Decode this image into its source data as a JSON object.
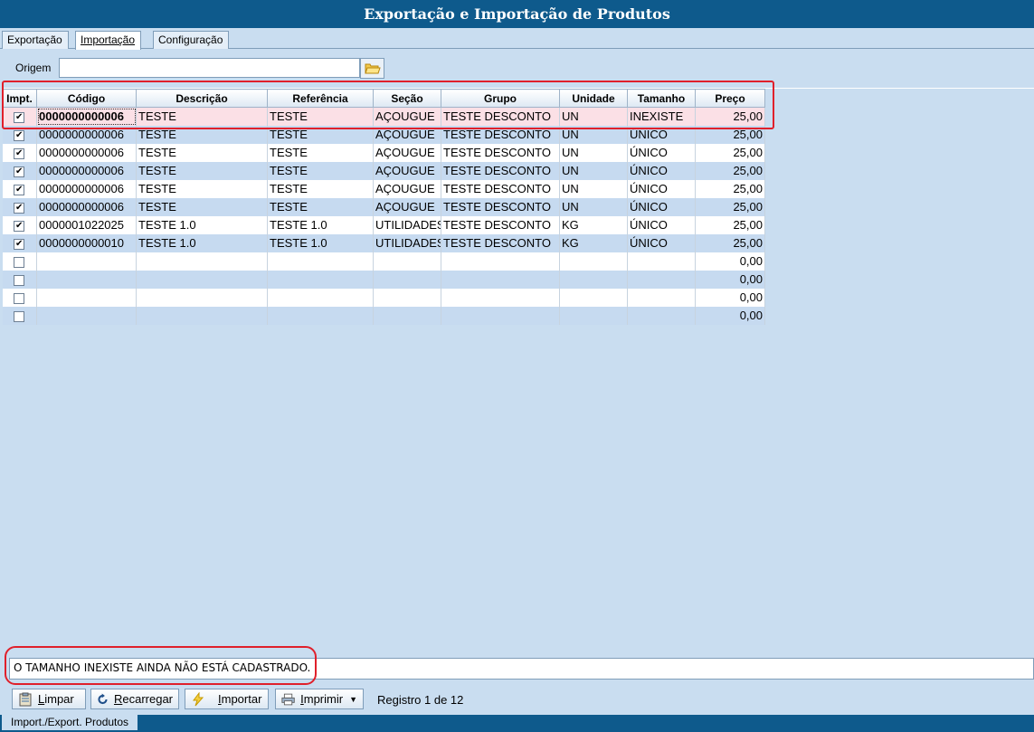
{
  "window": {
    "title": "Exportação e Importação de Produtos"
  },
  "tabs": [
    {
      "label": "Exportação"
    },
    {
      "label": "Importação"
    },
    {
      "label": "Configuração"
    }
  ],
  "origem": {
    "label": "Origem",
    "value": ""
  },
  "grid": {
    "columns": [
      "Impt.",
      "Código",
      "Descrição",
      "Referência",
      "Seção",
      "Grupo",
      "Unidade",
      "Tamanho",
      "Preço"
    ],
    "rows": [
      {
        "checked": true,
        "codigo": "0000000000006",
        "descricao": "TESTE",
        "referencia": "TESTE",
        "secao": "AÇOUGUE",
        "grupo": "TESTE DESCONTO",
        "unidade": "UN",
        "tamanho": "INEXISTE",
        "preco": "25,00"
      },
      {
        "checked": true,
        "codigo": "0000000000006",
        "descricao": "TESTE",
        "referencia": "TESTE",
        "secao": "AÇOUGUE",
        "grupo": "TESTE DESCONTO",
        "unidade": "UN",
        "tamanho": "ÚNICO",
        "preco": "25,00"
      },
      {
        "checked": true,
        "codigo": "0000000000006",
        "descricao": "TESTE",
        "referencia": "TESTE",
        "secao": "AÇOUGUE",
        "grupo": "TESTE DESCONTO",
        "unidade": "UN",
        "tamanho": "ÚNICO",
        "preco": "25,00"
      },
      {
        "checked": true,
        "codigo": "0000000000006",
        "descricao": "TESTE",
        "referencia": "TESTE",
        "secao": "AÇOUGUE",
        "grupo": "TESTE DESCONTO",
        "unidade": "UN",
        "tamanho": "ÚNICO",
        "preco": "25,00"
      },
      {
        "checked": true,
        "codigo": "0000000000006",
        "descricao": "TESTE",
        "referencia": "TESTE",
        "secao": "AÇOUGUE",
        "grupo": "TESTE DESCONTO",
        "unidade": "UN",
        "tamanho": "ÚNICO",
        "preco": "25,00"
      },
      {
        "checked": true,
        "codigo": "0000000000006",
        "descricao": "TESTE",
        "referencia": "TESTE",
        "secao": "AÇOUGUE",
        "grupo": "TESTE DESCONTO",
        "unidade": "UN",
        "tamanho": "ÚNICO",
        "preco": "25,00"
      },
      {
        "checked": true,
        "codigo": "0000001022025",
        "descricao": "TESTE 1.0",
        "referencia": "TESTE 1.0",
        "secao": "UTILIDADES",
        "grupo": "TESTE DESCONTO",
        "unidade": "KG",
        "tamanho": "ÚNICO",
        "preco": "25,00"
      },
      {
        "checked": true,
        "codigo": "0000000000010",
        "descricao": "TESTE 1.0",
        "referencia": "TESTE 1.0",
        "secao": "UTILIDADES",
        "grupo": "TESTE DESCONTO",
        "unidade": "KG",
        "tamanho": "ÚNICO",
        "preco": "25,00"
      },
      {
        "checked": false,
        "codigo": "",
        "descricao": "",
        "referencia": "",
        "secao": "",
        "grupo": "",
        "unidade": "",
        "tamanho": "",
        "preco": "0,00"
      },
      {
        "checked": false,
        "codigo": "",
        "descricao": "",
        "referencia": "",
        "secao": "",
        "grupo": "",
        "unidade": "",
        "tamanho": "",
        "preco": "0,00"
      },
      {
        "checked": false,
        "codigo": "",
        "descricao": "",
        "referencia": "",
        "secao": "",
        "grupo": "",
        "unidade": "",
        "tamanho": "",
        "preco": "0,00"
      },
      {
        "checked": false,
        "codigo": "",
        "descricao": "",
        "referencia": "",
        "secao": "",
        "grupo": "",
        "unidade": "",
        "tamanho": "",
        "preco": "0,00"
      }
    ]
  },
  "status_message": "O TAMANHO INEXISTE AINDA NÃO ESTÁ CADASTRADO.",
  "toolbar": {
    "limpar": "Limpar",
    "recarregar": "Recarregar",
    "importar": "Importar",
    "imprimir": "Imprimir",
    "registro": "Registro 1 de 12"
  },
  "bottom_tab": "Import./Export. Produtos",
  "colors": {
    "titlebar": "#0e5a8c",
    "background": "#c9ddf0",
    "highlight": "#e0202b",
    "selected_row": "#fbe0e6"
  }
}
